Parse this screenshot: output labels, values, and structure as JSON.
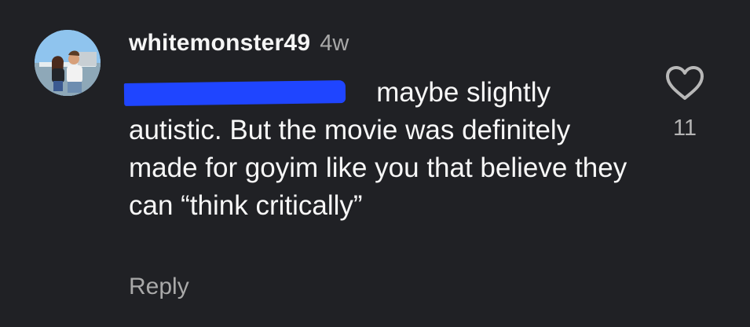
{
  "comment": {
    "username": "whitemonster49",
    "time_ago": "4w",
    "mention": "@",
    "text": " maybe slightly autistic. But the movie was definitely made for goyim like you that believe they can “think critically”",
    "reply_label": "Reply",
    "like_count": "11"
  },
  "icons": {
    "avatar": "profile-photo",
    "like": "heart-outline-icon"
  },
  "colors": {
    "background": "#202125",
    "text": "#f7f7f7",
    "muted": "#a9a9a9",
    "mention_redaction": "#1f45ff"
  }
}
